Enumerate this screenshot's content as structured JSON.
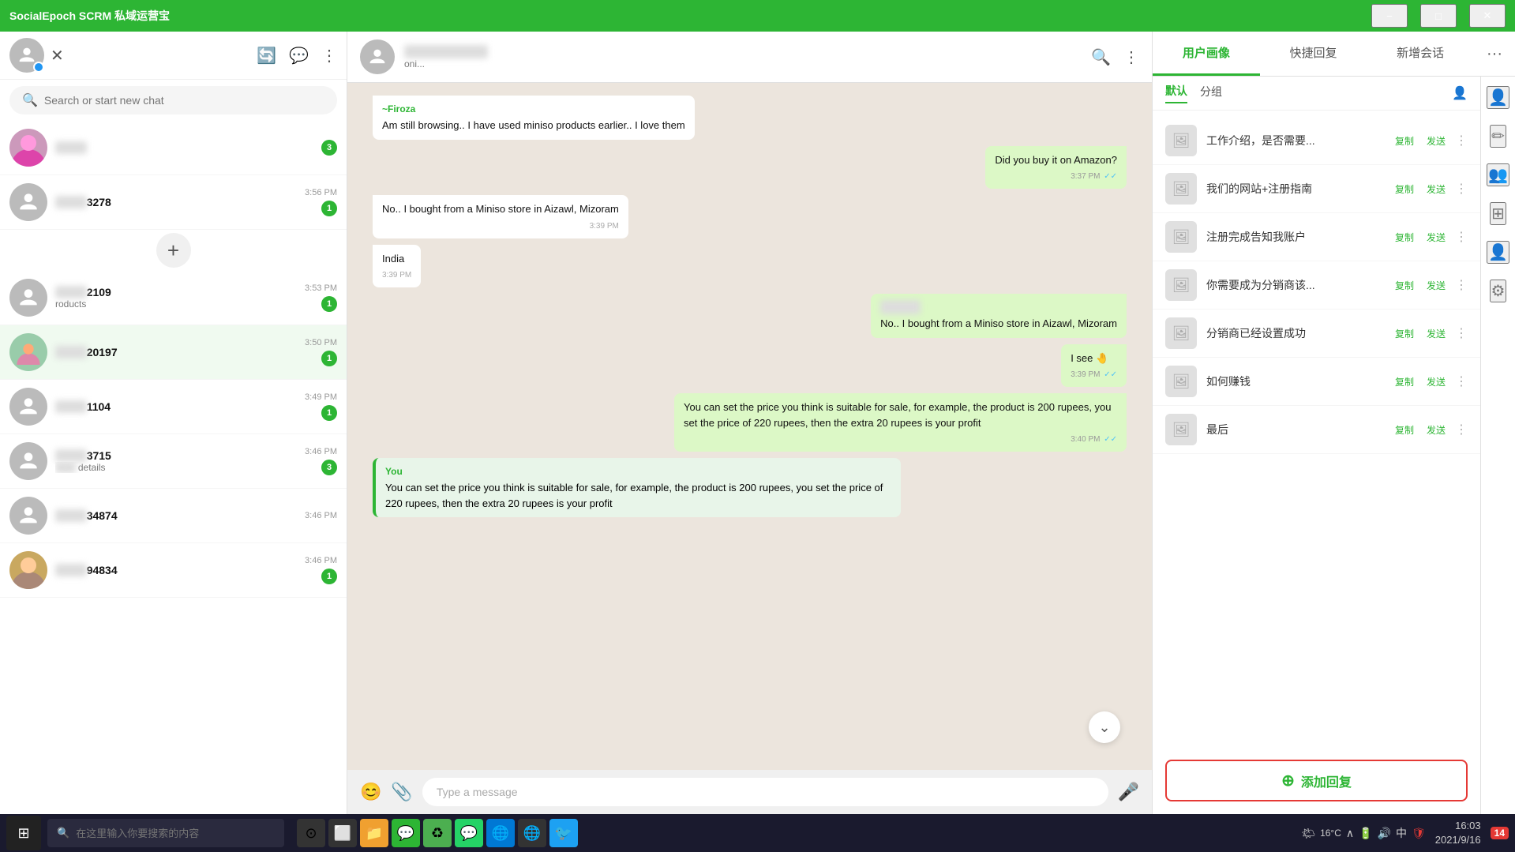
{
  "titleBar": {
    "title": "SocialEpoch SCRM 私域运营宝",
    "minimize": "−",
    "maximize": "□",
    "close": "✕"
  },
  "sidebar": {
    "searchPlaceholder": "Search or start new chat",
    "chats": [
      {
        "id": 1,
        "nameBlurred": true,
        "nameSuffix": "3278",
        "time": "3:56 PM",
        "badge": 1,
        "preview": ""
      },
      {
        "id": 2,
        "nameBlurred": true,
        "nameSuffix": "2109",
        "time": "3:53 PM",
        "badge": 1,
        "preview": "roducts"
      },
      {
        "id": 3,
        "nameBlurred": true,
        "nameSuffix": "20197",
        "time": "3:50 PM",
        "badge": 1,
        "preview": ""
      },
      {
        "id": 4,
        "nameBlurred": true,
        "nameSuffix": "1104",
        "time": "3:49 PM",
        "badge": 1,
        "preview": ""
      },
      {
        "id": 5,
        "nameBlurred": true,
        "nameSuffix": "3715",
        "time": "3:46 PM",
        "badge": 3,
        "preview": "details"
      },
      {
        "id": 6,
        "nameBlurred": true,
        "nameSuffix": "34874",
        "time": "3:46 PM",
        "badge": 0,
        "preview": ""
      },
      {
        "id": 7,
        "nameBlurred": true,
        "nameSuffix": "94834",
        "time": "3:46 PM",
        "badge": 1,
        "preview": ""
      }
    ],
    "addButton": "+"
  },
  "chatHeader": {
    "name": "████████",
    "status": "oni...",
    "searchIcon": "🔍",
    "moreIcon": "⋮"
  },
  "messages": [
    {
      "id": 1,
      "type": "incoming",
      "sender": "~Firoza",
      "text": "Am still browsing.. I have used miniso products earlier.. I love them",
      "time": null
    },
    {
      "id": 2,
      "type": "outgoing",
      "text": "Did you buy it on Amazon?",
      "time": "3:37 PM",
      "checkmark": "✓✓"
    },
    {
      "id": 3,
      "type": "incoming",
      "text": "No.. I bought from a Miniso store in Aizawl, Mizoram",
      "time": "3:39 PM"
    },
    {
      "id": 4,
      "type": "incoming",
      "text": "India",
      "time": "3:39 PM"
    },
    {
      "id": 5,
      "type": "outgoing",
      "sender": "Sender",
      "text": "No.. I bought from a Miniso store in Aizawl, Mizoram",
      "time": null
    },
    {
      "id": 6,
      "type": "outgoing",
      "text": "I see 🤚",
      "time": "3:39 PM",
      "checkmark": "✓✓"
    },
    {
      "id": 7,
      "type": "outgoing",
      "text": "You can set the price you think is suitable for sale, for example, the product is 200 rupees, you set the price of 220 rupees, then the extra 20 rupees is your profit",
      "time": "3:40 PM",
      "checkmark": "✓✓"
    },
    {
      "id": 8,
      "type": "you",
      "sender": "You",
      "text": "You can set the price you think is suitable for sale, for example, the product is 200 rupees, you set the price of 220 rupees, then the extra 20 rupees is your profit",
      "time": null
    }
  ],
  "inputArea": {
    "placeholder": "Type a message",
    "emojiIcon": "😊",
    "attachIcon": "📎",
    "micIcon": "🎤"
  },
  "rightPanel": {
    "tabs": [
      "用户画像",
      "快捷回复",
      "新增会话"
    ],
    "moreIcon": "···",
    "subTabs": [
      "默认",
      "分组"
    ],
    "sideIcons": [
      "👤",
      "🔧",
      "👥",
      "⬛⬛",
      "👤",
      "⚙"
    ],
    "quickReplies": [
      {
        "id": 1,
        "text": "工作介绍，是否需要..."
      },
      {
        "id": 2,
        "text": "我们的网站+注册指南"
      },
      {
        "id": 3,
        "text": "注册完成告知我账户"
      },
      {
        "id": 4,
        "text": "你需要成为分销商该..."
      },
      {
        "id": 5,
        "text": "分销商已经设置成功"
      },
      {
        "id": 6,
        "text": "如何赚钱"
      },
      {
        "id": 7,
        "text": "最后"
      }
    ],
    "actionLabels": {
      "copy": "复制",
      "send": "发送"
    },
    "addReplyLabel": "添加回复",
    "addReplyIcon": "+"
  },
  "taskbar": {
    "searchPlaceholder": "在这里输入你要搜索的内容",
    "icons": [
      "⊙",
      "⬜",
      "📁",
      "💬",
      "♻",
      "🌐",
      "🦊",
      "🐦"
    ],
    "sysIcons": [
      "🌤",
      "16°C",
      "∧",
      "🔋",
      "🔊",
      "中",
      "🛡"
    ],
    "time": "16:03",
    "date": "2021/9/16",
    "notifBadge": "14"
  }
}
